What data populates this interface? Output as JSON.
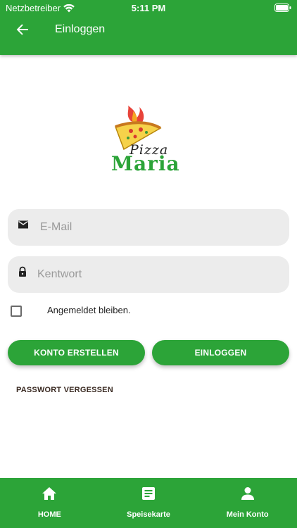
{
  "status_bar": {
    "carrier": "Netzbetreiber",
    "time": "5:11 PM"
  },
  "app_bar": {
    "title": "Einloggen"
  },
  "logo": {
    "word_top": "Pizza",
    "word_bottom": "Maria"
  },
  "form": {
    "email_placeholder": "E-Mail",
    "password_placeholder": "Kentwort",
    "remember_label": "Angemeldet bleiben.",
    "create_account_label": "KONTO ERSTELLEN",
    "login_label": "EINLOGGEN",
    "forgot_password_label": "PASSWORT VERGESSEN"
  },
  "bottom_nav": {
    "items": [
      {
        "label": "HOME",
        "icon": "home-icon"
      },
      {
        "label": "Speisekarte",
        "icon": "menu-icon"
      },
      {
        "label": "Mein Konto",
        "icon": "account-icon"
      }
    ]
  },
  "colors": {
    "primary": "#2ca438",
    "field_bg": "#ececec"
  }
}
